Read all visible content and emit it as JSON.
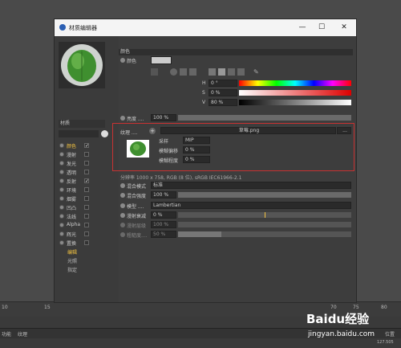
{
  "window": {
    "title": "材质编辑器",
    "minimize": "—",
    "maximize": "☐",
    "close": "✕"
  },
  "material_name": "材质",
  "channels": [
    {
      "label": "颜色",
      "checked": true,
      "active": true
    },
    {
      "label": "漫射",
      "checked": false
    },
    {
      "label": "发光",
      "checked": false
    },
    {
      "label": "透明",
      "checked": false
    },
    {
      "label": "反射",
      "checked": true
    },
    {
      "label": "环境",
      "checked": false
    },
    {
      "label": "烟雾",
      "checked": false
    },
    {
      "label": "凹凸",
      "checked": false
    },
    {
      "label": "法线",
      "checked": false
    },
    {
      "label": "Alpha",
      "checked": false
    },
    {
      "label": "辉光",
      "checked": false
    },
    {
      "label": "置换",
      "checked": false
    }
  ],
  "subitems": [
    {
      "label": "编辑",
      "active": true
    },
    {
      "label": "光照"
    },
    {
      "label": "指定"
    }
  ],
  "color_section": {
    "header": "颜色",
    "color_label": "颜色",
    "h_label": "H",
    "h_value": "0 °",
    "s_label": "S",
    "s_value": "0 %",
    "v_label": "V",
    "v_value": "80 %",
    "brightness_label": "亮度 ....",
    "brightness_value": "100 %"
  },
  "texture": {
    "label": "纹理 ....",
    "file": "草莓.png",
    "more": "...",
    "sampling_label": "采样",
    "sampling_value": "MIP",
    "blur_offset_label": "模糊偏移",
    "blur_offset_value": "0 %",
    "blur_scale_label": "模糊程度",
    "blur_scale_value": "0 %",
    "resolution": "分辨率 1000 x 758, RGB (8 位), sRGB IEC61966-2.1"
  },
  "mix": {
    "mode_label": "混合模式",
    "mode_value": "标准",
    "strength_label": "混合强度",
    "strength_value": "100 %"
  },
  "model": {
    "label": "模型 ....",
    "value": "Lambertian",
    "diffuse_falloff_label": "漫射衰减",
    "diffuse_falloff_value": "0 %",
    "diffuse_level_label": "漫射层级",
    "diffuse_level_value": "100 %",
    "roughness_label": "粗糙度....",
    "roughness_value": "50 %"
  },
  "timeline": {
    "ticks": [
      "10",
      "15",
      "70",
      "75",
      "80"
    ]
  },
  "statusbar": {
    "left1": "功能",
    "left2": "纹理",
    "right": "位置"
  },
  "coordinate": "127.505",
  "watermark": {
    "brand": "Baidu经验",
    "url": "jingyan.baidu.com"
  },
  "colors": {
    "accent": "#f0c040",
    "highlight_box": "#c83232"
  }
}
